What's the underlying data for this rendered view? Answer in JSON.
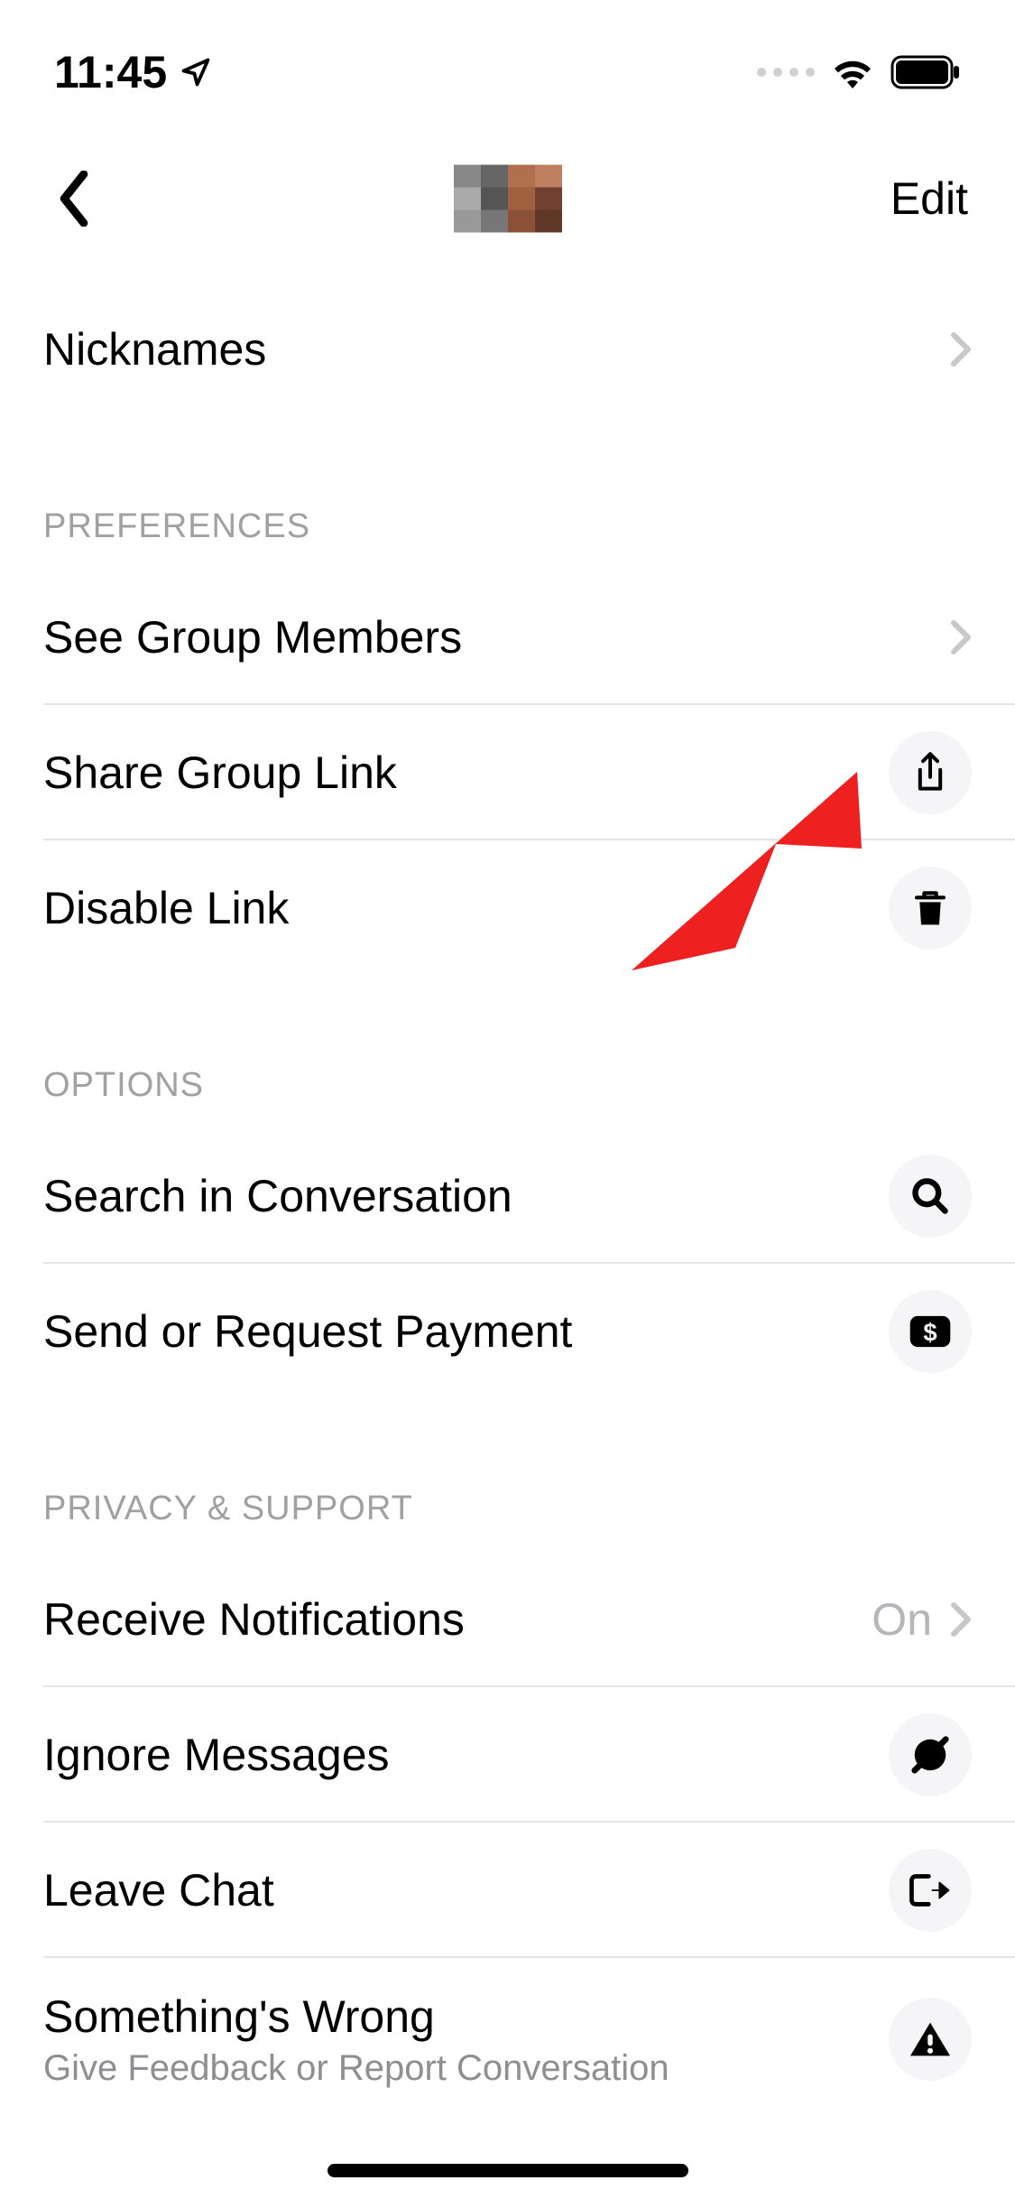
{
  "status": {
    "time": "11:45"
  },
  "header": {
    "edit_label": "Edit"
  },
  "rows": {
    "nicknames": "Nicknames"
  },
  "sections": {
    "preferences": {
      "header": "PREFERENCES",
      "see_members": "See Group Members",
      "share_link": "Share Group Link",
      "disable_link": "Disable Link"
    },
    "options": {
      "header": "OPTIONS",
      "search": "Search in Conversation",
      "payment": "Send or Request Payment"
    },
    "privacy": {
      "header": "PRIVACY & SUPPORT",
      "notifications": "Receive Notifications",
      "notifications_value": "On",
      "ignore": "Ignore Messages",
      "leave": "Leave Chat",
      "wrong": "Something's Wrong",
      "wrong_sub": "Give Feedback or Report Conversation"
    }
  }
}
